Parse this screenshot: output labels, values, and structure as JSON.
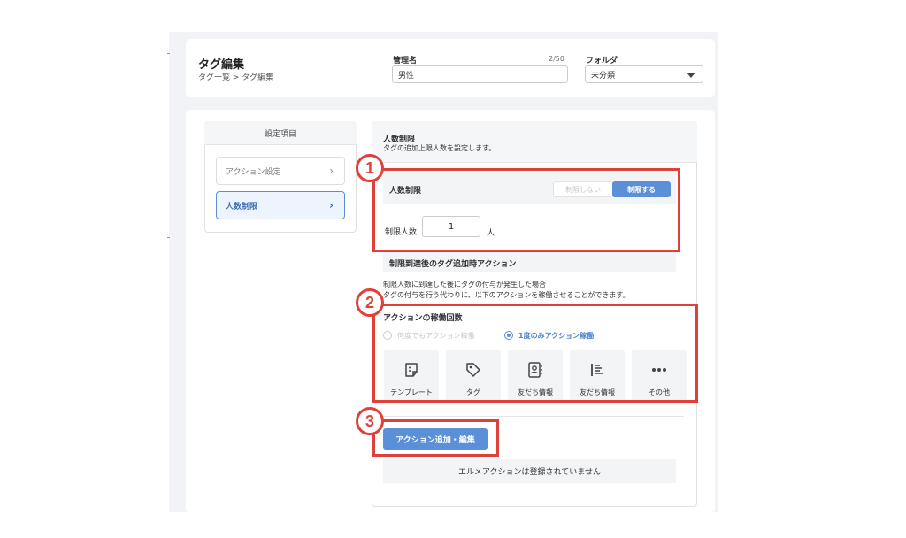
{
  "header": {
    "title": "タグ編集",
    "breadcrumb_link": "タグ一覧",
    "breadcrumb_sep": " > ",
    "breadcrumb_current": "タグ編集",
    "name_label": "管理名",
    "name_counter": "2/50",
    "name_value": "男性",
    "folder_label": "フォルダ",
    "folder_value": "未分類"
  },
  "sidebar": {
    "heading": "設定項目",
    "items": [
      {
        "label": "アクション設定",
        "active": false
      },
      {
        "label": "人数制限",
        "active": true
      }
    ]
  },
  "panel": {
    "title": "人数制限",
    "description": "タグの追加上限人数を設定します。",
    "limit_section_title": "人数制限",
    "toggle_off": "制限しない",
    "toggle_on": "制限する",
    "limit_count_label": "制限人数",
    "limit_count_value": "1",
    "limit_unit": "人",
    "after_limit_title": "制限到達後のタグ追加時アクション",
    "after_limit_desc_1": "制限人数に到達した後にタグの付与が発生した場合",
    "after_limit_desc_2": "タグの付与を行う代わりに、以下のアクションを稼働させることができます。",
    "action_count_title": "アクションの稼働回数",
    "radio_any": "何度でもアクション稼働",
    "radio_once": "1度のみアクション稼働",
    "tiles": [
      {
        "label": "テンプレート",
        "icon": "template-icon"
      },
      {
        "label": "タグ",
        "icon": "tag-icon"
      },
      {
        "label": "友だち情報",
        "icon": "contact-card-icon"
      },
      {
        "label": "友だち情報",
        "icon": "list-icon"
      },
      {
        "label": "その他",
        "icon": "more-icon"
      }
    ],
    "action_button": "アクション追加・編集",
    "empty_message": "エルメアクションは登録されていません"
  },
  "annotations": {
    "badge_1": "1",
    "badge_2": "2",
    "badge_3": "3"
  },
  "colors": {
    "accent": "#5b8fd8",
    "annotation_red": "#e0403a"
  }
}
